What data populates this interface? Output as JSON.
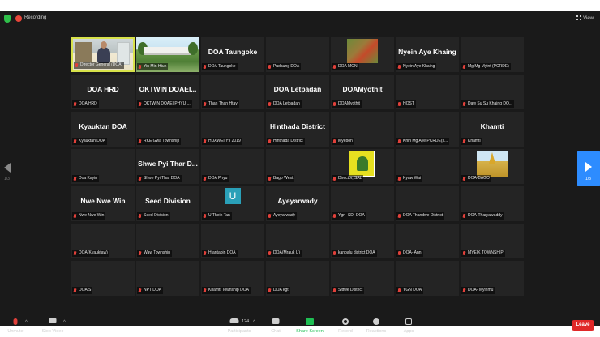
{
  "topbar": {
    "recording_label": "Recording",
    "view_label": "View"
  },
  "nav": {
    "left_page": "1/3",
    "right_page": "1/3"
  },
  "tiles": [
    {
      "title": "",
      "label": "Director General (DOA)",
      "video": "room",
      "active": true,
      "muted": false
    },
    {
      "title": "",
      "label": "Yin Min Htun",
      "video": "campus"
    },
    {
      "title": "DOA Taungoke",
      "label": "DOA Taungoke"
    },
    {
      "title": "",
      "label": "Padaung DOA"
    },
    {
      "title": "",
      "label": "DOA MON",
      "video": "farm"
    },
    {
      "title": "Nyein Aye Khaing",
      "label": "Nyein Aye Khaing"
    },
    {
      "title": "",
      "label": "Mg Mg Myint (PCRDE)"
    },
    {
      "title": "DOA HRD",
      "label": "DOA HRD"
    },
    {
      "title": "OKTWIN DOAEI...",
      "label": "OKTWIN DOAEI PHYU ..."
    },
    {
      "title": "",
      "label": "Than Than Htay"
    },
    {
      "title": "DOA Letpadan",
      "label": "DOA Letpadan"
    },
    {
      "title": "DOAMyothit",
      "label": "DOAMyothit"
    },
    {
      "title": "",
      "label": "HOST"
    },
    {
      "title": "",
      "label": "Daw Su Su Khaing DO..."
    },
    {
      "title": "Kyauktan DOA",
      "label": "Kyauktan DOA"
    },
    {
      "title": "",
      "label": "RKE Gwa Township"
    },
    {
      "title": "",
      "label": "HUAWEI Y9 2019"
    },
    {
      "title": "Hinthada District",
      "label": "Hinthada District"
    },
    {
      "title": "",
      "label": "Myebon"
    },
    {
      "title": "",
      "label": "Khin Mg Aye PCRDE(s..."
    },
    {
      "title": "Khamti",
      "label": "Khamti"
    },
    {
      "title": "",
      "label": "Doa Kayin"
    },
    {
      "title": "Shwe Pyi Thar D...",
      "label": "Shwe Pyi Thar DOA"
    },
    {
      "title": "",
      "label": "DOA Phyu"
    },
    {
      "title": "",
      "label": "Bago West"
    },
    {
      "title": "",
      "label": "Director, SAL",
      "video": "logo"
    },
    {
      "title": "",
      "label": "Kyaw Wai"
    },
    {
      "title": "",
      "label": "DOA-BAGO",
      "video": "pagoda"
    },
    {
      "title": "Nwe Nwe Win",
      "label": "Nwe Nwe Win"
    },
    {
      "title": "Seed Division",
      "label": "Seed Division"
    },
    {
      "title": "",
      "label": "U Thein Tan",
      "video": "avatar",
      "avatar_letter": "U"
    },
    {
      "title": "Ayeyarwady",
      "label": "Ayeyarwady"
    },
    {
      "title": "",
      "label": "Ygn- SD -DOA"
    },
    {
      "title": "",
      "label": "DOA Thandwe District"
    },
    {
      "title": "",
      "label": "DOA-Tharyawaddy"
    },
    {
      "title": "",
      "label": "DOA(Kyauktaw)"
    },
    {
      "title": "",
      "label": "Waw Township"
    },
    {
      "title": "",
      "label": "Htantapin DOA"
    },
    {
      "title": "",
      "label": "DOA(Mrauk U)"
    },
    {
      "title": "",
      "label": "kanbalu district DOA"
    },
    {
      "title": "",
      "label": "DOA- Ann"
    },
    {
      "title": "",
      "label": "MYEIK TOWNSHIP"
    },
    {
      "title": "",
      "label": "DOA S"
    },
    {
      "title": "",
      "label": "NPT DOA"
    },
    {
      "title": "",
      "label": "Khamti Township DOA"
    },
    {
      "title": "",
      "label": "DOA kgt"
    },
    {
      "title": "",
      "label": "Sittwe District"
    },
    {
      "title": "",
      "label": "YGN DOA"
    },
    {
      "title": "",
      "label": "DOA- Myinmu"
    }
  ],
  "toolbar": {
    "unmute": "Unmute",
    "stop_video": "Stop Video",
    "participants": "Participants",
    "participant_count": "124",
    "chat": "Chat",
    "share_screen": "Share Screen",
    "record": "Record",
    "reactions": "Reactions",
    "apps": "Apps",
    "leave": "Leave"
  },
  "colors": {
    "accent_blue": "#2d8cff",
    "leave_red": "#e02828",
    "share_green": "#1fbf54",
    "active_border": "#d8e24a"
  }
}
